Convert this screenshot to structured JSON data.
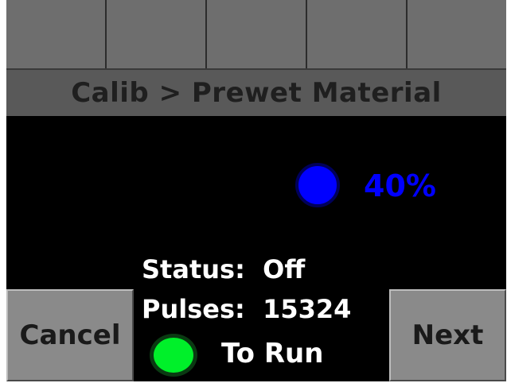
{
  "tabs": [
    "",
    "",
    "",
    "",
    ""
  ],
  "header": {
    "title": "Calib > Prewet Material"
  },
  "rate": {
    "value": "40%",
    "indicator_color": "#0000ff"
  },
  "status": {
    "label": "Status:",
    "value": "Off"
  },
  "pulses": {
    "label": "Pulses:",
    "value": "15324"
  },
  "run": {
    "label": "To Run",
    "indicator_color": "#00f02a"
  },
  "buttons": {
    "cancel": "Cancel",
    "next": "Next"
  }
}
